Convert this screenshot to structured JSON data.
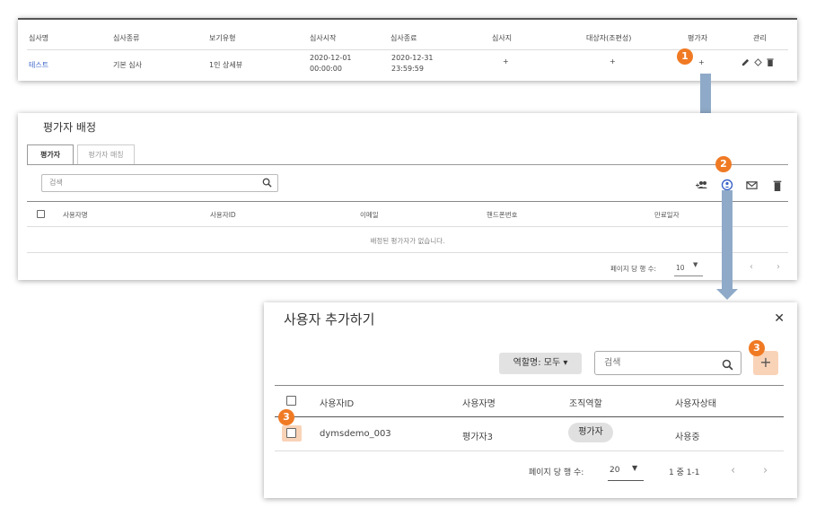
{
  "review_table": {
    "headers": [
      "심사명",
      "심사종류",
      "보기유형",
      "심사시작",
      "심사종료",
      "심사지",
      "대상자(조편성)",
      "평가자",
      "관리"
    ],
    "row": {
      "name": "테스트",
      "type": "기본 심사",
      "view_type": "1인 상세뷰",
      "start_date": "2020-12-01",
      "start_time": "00:00:00",
      "end_date": "2020-12-31",
      "end_time": "23:59:59",
      "sheet_plus": "+",
      "target_plus": "+",
      "evaluator_plus": "+"
    }
  },
  "steps": {
    "s1": "1",
    "s2": "2",
    "s3a": "3",
    "s3b": "3"
  },
  "assign_dialog": {
    "title": "평가자 배정",
    "tabs": [
      "평가자",
      "평가자 매칭"
    ],
    "search_placeholder": "검색",
    "columns": [
      "사용자명",
      "사용자ID",
      "이메일",
      "핸드폰번호",
      "만료일자"
    ],
    "empty_text": "배정된 평가자가 없습니다.",
    "rows_per_page_label": "페이지 당 행 수:",
    "rows_per_page": "10"
  },
  "add_user_dialog": {
    "title": "사용자 추가하기",
    "close": "✕",
    "role_filter": "역할명: 모두 ▾",
    "search_placeholder": "검색",
    "add_label": "+",
    "columns": [
      "사용자ID",
      "사용자명",
      "조직역할",
      "사용자상태"
    ],
    "rows": [
      {
        "user_id": "dymsdemo_003",
        "user_name": "평가자3",
        "role": "평가자",
        "status": "사용중"
      }
    ],
    "rows_per_page_label": "페이지 당 행 수:",
    "rows_per_page": "20",
    "range": "1 중 1-1"
  },
  "colors": {
    "accent": "#f07a24",
    "link": "#3a63c8",
    "arrow": "#8faac8",
    "add_bg": "#f9d3b8"
  }
}
